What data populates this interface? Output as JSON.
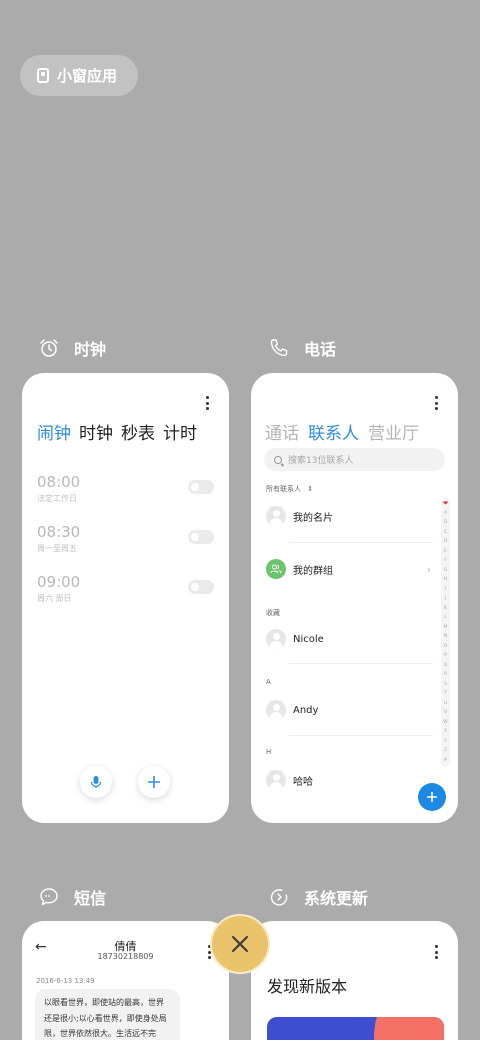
{
  "mini_window": {
    "label": "小窗应用"
  },
  "apps": {
    "clock": {
      "name": "时钟",
      "tabs": [
        "闹钟",
        "时钟",
        "秒表",
        "计时"
      ],
      "alarms": [
        {
          "time": "08:00",
          "repeat": "法定工作日"
        },
        {
          "time": "08:30",
          "repeat": "周一至周五"
        },
        {
          "time": "09:00",
          "repeat": "周六 周日"
        }
      ]
    },
    "phone": {
      "name": "电话",
      "tabs": [
        "通话",
        "联系人",
        "营业厅"
      ],
      "search_placeholder": "搜索13位联系人",
      "all_contacts_label": "所有联系人",
      "my_card": "我的名片",
      "my_groups": "我的群组",
      "favorites_label": "收藏",
      "favorite_contact": "Nicole",
      "section_a": "A",
      "contact_a": "Andy",
      "section_h": "H",
      "contact_h": "哈哈",
      "alphabet": [
        "A",
        "B",
        "C",
        "D",
        "E",
        "F",
        "G",
        "H",
        "I",
        "J",
        "K",
        "L",
        "M",
        "N",
        "O",
        "P",
        "Q",
        "R",
        "S",
        "T",
        "U",
        "V",
        "W",
        "X",
        "Y",
        "Z",
        "#"
      ]
    },
    "messages": {
      "name": "短信",
      "contact_name": "倩倩",
      "phone_number": "18730218809",
      "date": "2016-6-13 13:49",
      "body": "以眼看世界，即使站的最高，世界还是很小;以心看世界，即使身处局限，世界依然很大。生活远不完美，需要用心去体会;不理解事由"
    },
    "update": {
      "name": "系统更新",
      "title": "发现新版本"
    }
  },
  "colors": {
    "accent": "#2b8de3",
    "background": "#ababab",
    "close_button": "#e9c46d"
  }
}
